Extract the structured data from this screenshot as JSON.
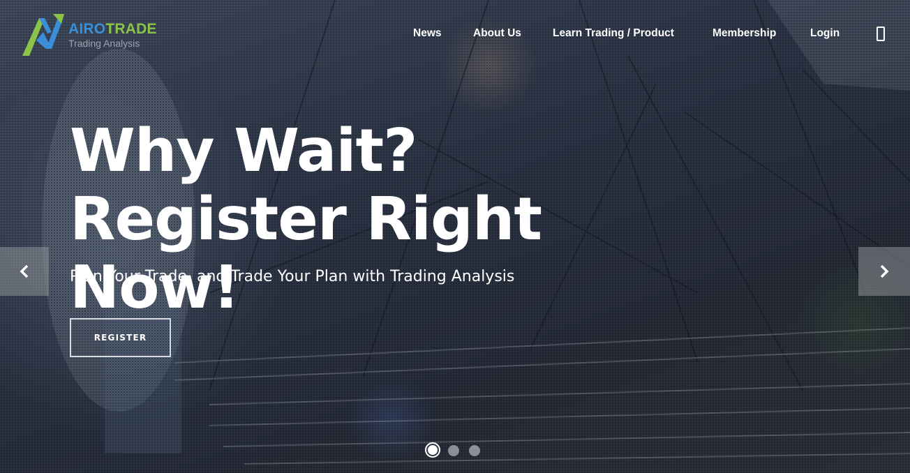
{
  "brand": {
    "name_part1": "AIRO",
    "name_part2": "TRADE",
    "tagline": "Trading Analysis",
    "colors": {
      "blue": "#3a8fd8",
      "green": "#8bc34a"
    }
  },
  "nav": {
    "items": [
      {
        "label": "News"
      },
      {
        "label": "About Us"
      },
      {
        "label": "Learn Trading / Product"
      },
      {
        "label": "Membership"
      },
      {
        "label": "Login"
      }
    ],
    "mobile_icon": "mobile-phone-icon"
  },
  "hero": {
    "headline": "Why Wait? Register Right Now!",
    "subheadline": "Plan Your Trade, and Trade Your Plan with Trading Analysis",
    "cta_label": "REGISTER"
  },
  "carousel": {
    "prev_icon": "chevron-left-icon",
    "next_icon": "chevron-right-icon",
    "slide_count": 3,
    "active_slide": 1
  }
}
